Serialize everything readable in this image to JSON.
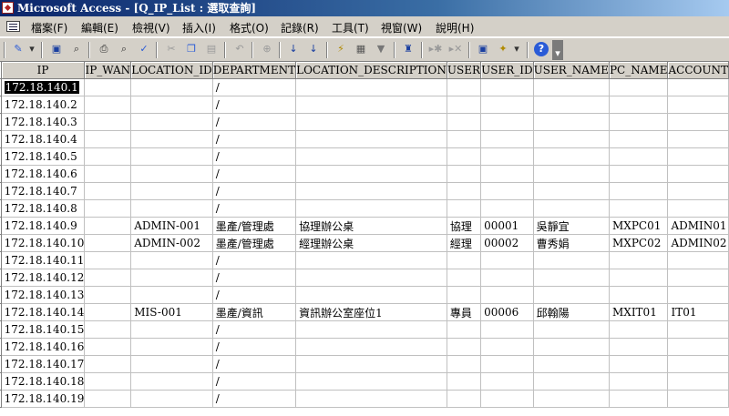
{
  "window": {
    "title": "Microsoft Access - [Q_IP_List : 選取查詢]"
  },
  "menu": {
    "items": [
      "檔案(F)",
      "編輯(E)",
      "檢視(V)",
      "插入(I)",
      "格式(O)",
      "記錄(R)",
      "工具(T)",
      "視窗(W)",
      "說明(H)"
    ]
  },
  "toolbar": {
    "icons": [
      "view-icon",
      "dropdown-arrow-icon",
      "save-icon",
      "search-file-icon",
      "print-icon",
      "print-preview-icon",
      "spelling-icon",
      "cut-icon",
      "copy-icon",
      "paste-icon",
      "undo-icon",
      "hyperlink-icon",
      "sort-ascending-icon",
      "sort-descending-icon",
      "filter-by-selection-icon",
      "filter-by-form-icon",
      "apply-filter-icon",
      "find-icon",
      "new-record-icon",
      "delete-record-icon",
      "database-window-icon",
      "new-object-icon",
      "new-object-dropdown-icon",
      "help-icon",
      "toolbar-options-icon"
    ]
  },
  "datasheet": {
    "columns": [
      "IP",
      "IP_WAN",
      "LOCATION_ID",
      "DEPARTMENT",
      "LOCATION_DESCRIPTION",
      "USER",
      "USER_ID",
      "USER_NAME",
      "PC_NAME",
      "ACCOUNT"
    ],
    "rows": [
      [
        "172.18.140.1",
        "",
        "",
        "/",
        "",
        "",
        "",
        "",
        "",
        ""
      ],
      [
        "172.18.140.2",
        "",
        "",
        "/",
        "",
        "",
        "",
        "",
        "",
        ""
      ],
      [
        "172.18.140.3",
        "",
        "",
        "/",
        "",
        "",
        "",
        "",
        "",
        ""
      ],
      [
        "172.18.140.4",
        "",
        "",
        "/",
        "",
        "",
        "",
        "",
        "",
        ""
      ],
      [
        "172.18.140.5",
        "",
        "",
        "/",
        "",
        "",
        "",
        "",
        "",
        ""
      ],
      [
        "172.18.140.6",
        "",
        "",
        "/",
        "",
        "",
        "",
        "",
        "",
        ""
      ],
      [
        "172.18.140.7",
        "",
        "",
        "/",
        "",
        "",
        "",
        "",
        "",
        ""
      ],
      [
        "172.18.140.8",
        "",
        "",
        "/",
        "",
        "",
        "",
        "",
        "",
        ""
      ],
      [
        "172.18.140.9",
        "",
        "ADMIN-001",
        "墨產/管理處",
        "協理辦公桌",
        "協理",
        "00001",
        "吳靜宜",
        "MXPC01",
        "ADMIN01"
      ],
      [
        "172.18.140.10",
        "",
        "ADMIN-002",
        "墨產/管理處",
        "經理辦公桌",
        "經理",
        "00002",
        "曹秀娟",
        "MXPC02",
        "ADMIN02"
      ],
      [
        "172.18.140.11",
        "",
        "",
        "/",
        "",
        "",
        "",
        "",
        "",
        ""
      ],
      [
        "172.18.140.12",
        "",
        "",
        "/",
        "",
        "",
        "",
        "",
        "",
        ""
      ],
      [
        "172.18.140.13",
        "",
        "",
        "/",
        "",
        "",
        "",
        "",
        "",
        ""
      ],
      [
        "172.18.140.14",
        "",
        "MIS-001",
        "墨產/資訊",
        "資訊辦公室座位1",
        "專員",
        "00006",
        "邱翰陽",
        "MXIT01",
        "IT01"
      ],
      [
        "172.18.140.15",
        "",
        "",
        "/",
        "",
        "",
        "",
        "",
        "",
        ""
      ],
      [
        "172.18.140.16",
        "",
        "",
        "/",
        "",
        "",
        "",
        "",
        "",
        ""
      ],
      [
        "172.18.140.17",
        "",
        "",
        "/",
        "",
        "",
        "",
        "",
        "",
        ""
      ],
      [
        "172.18.140.18",
        "",
        "",
        "/",
        "",
        "",
        "",
        "",
        "",
        ""
      ],
      [
        "172.18.140.19",
        "",
        "",
        "/",
        "",
        "",
        "",
        "",
        "",
        ""
      ]
    ]
  }
}
